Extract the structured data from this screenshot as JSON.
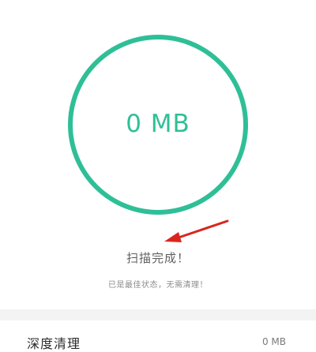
{
  "scan": {
    "size_value": "0 MB",
    "status_title": "扫描完成！",
    "status_subtitle": "已是最佳状态，无需清理！"
  },
  "deep_clean": {
    "label": "深度清理",
    "value": "0 MB"
  },
  "colors": {
    "ring": "#2fbf97",
    "annotation_arrow": "#d8261e"
  },
  "icons": {
    "annotation": "red-arrow-icon"
  }
}
